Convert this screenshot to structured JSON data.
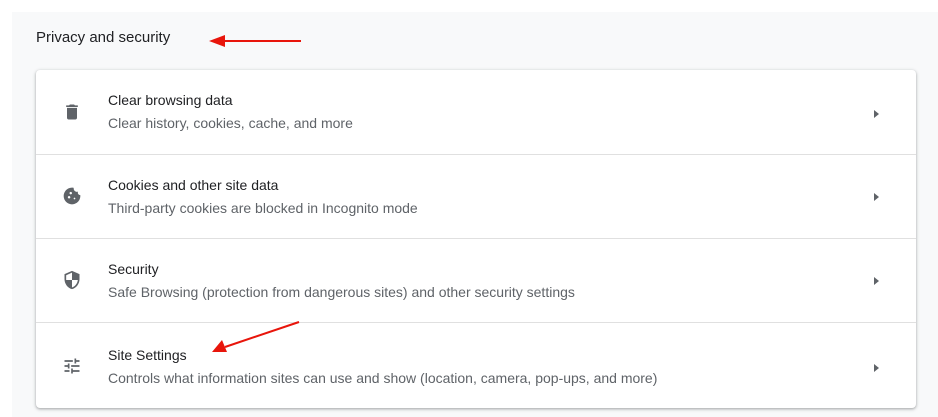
{
  "section": {
    "title": "Privacy and security"
  },
  "rows": [
    {
      "icon": "trash-icon",
      "label": "Clear browsing data",
      "sublabel": "Clear history, cookies, cache, and more"
    },
    {
      "icon": "cookie-icon",
      "label": "Cookies and other site data",
      "sublabel": "Third-party cookies are blocked in Incognito mode"
    },
    {
      "icon": "shield-icon",
      "label": "Security",
      "sublabel": "Safe Browsing (protection from dangerous sites) and other security settings"
    },
    {
      "icon": "tune-icon",
      "label": "Site Settings",
      "sublabel": "Controls what information sites can use and show (location, camera, pop-ups, and more)"
    }
  ],
  "colors": {
    "annotation_arrow": "#e8150b",
    "icon": "#5f6368",
    "text_primary": "#202124",
    "text_secondary": "#5f6368"
  }
}
